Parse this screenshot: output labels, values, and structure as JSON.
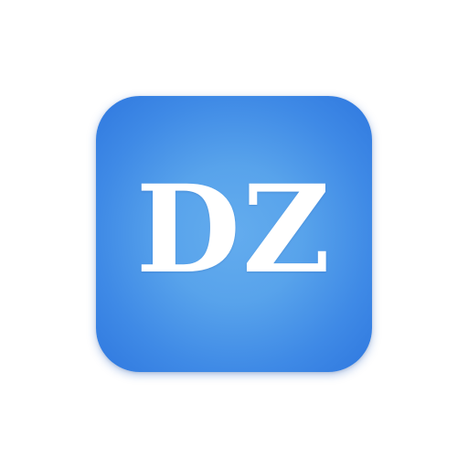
{
  "app_icon": {
    "label": "DZ",
    "colors": {
      "gradient_center": "#63acee",
      "gradient_edge": "#2f78df",
      "label": "#ffffff",
      "background": "#ffffff"
    }
  }
}
